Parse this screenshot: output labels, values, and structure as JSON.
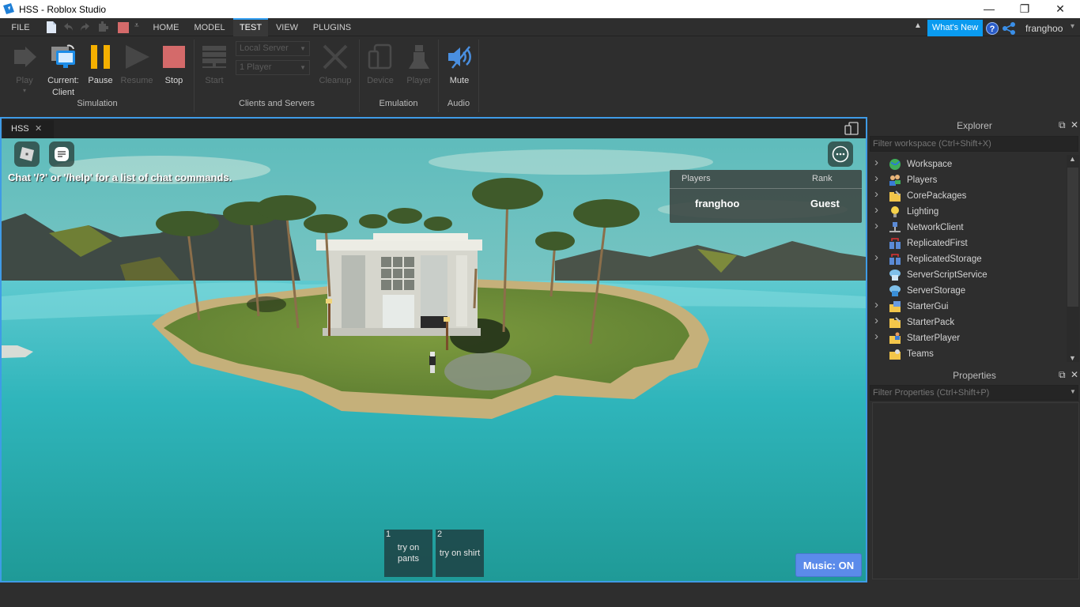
{
  "window": {
    "title": "HSS - Roblox Studio",
    "controls": {
      "minimize": "—",
      "restore": "❐",
      "close": "✕"
    }
  },
  "menubar": {
    "file": "FILE",
    "tabs": [
      {
        "label": "HOME",
        "active": false
      },
      {
        "label": "MODEL",
        "active": false
      },
      {
        "label": "TEST",
        "active": true
      },
      {
        "label": "VIEW",
        "active": false
      },
      {
        "label": "PLUGINS",
        "active": false
      }
    ],
    "quick_access_icons": [
      "new-file-icon",
      "undo-icon",
      "redo-icon",
      "plugin-icon",
      "stop-square-icon",
      "customize-icon"
    ],
    "whats_new": "What's New",
    "user": "franghoo",
    "collapse_glyph": "▲",
    "user_caret": "▾"
  },
  "ribbon": {
    "groups": [
      {
        "label": "Simulation"
      },
      {
        "label": "Clients and Servers"
      },
      {
        "label": "Emulation"
      },
      {
        "label": "Audio"
      }
    ],
    "buttons": {
      "play": {
        "label": "Play",
        "enabled": false
      },
      "current_client": {
        "label_1": "Current:",
        "label_2": "Client",
        "enabled": true
      },
      "pause": {
        "label": "Pause",
        "enabled": true
      },
      "resume": {
        "label": "Resume",
        "enabled": false
      },
      "stop": {
        "label": "Stop",
        "enabled": true
      },
      "start": {
        "label": "Start",
        "enabled": false
      },
      "cleanup": {
        "label": "Cleanup",
        "enabled": false
      },
      "device": {
        "label": "Device",
        "enabled": false
      },
      "player": {
        "label": "Player",
        "enabled": false
      },
      "mute": {
        "label": "Mute",
        "enabled": true
      }
    },
    "server_dropdown": "Local Server",
    "players_dropdown": "1 Player",
    "colors": {
      "pause": "#f5b000",
      "stop": "#d46a6a",
      "mute": "#4a8fe0"
    }
  },
  "document": {
    "tab_label": "HSS",
    "tab_close": "✕"
  },
  "game": {
    "chat_hint": "Chat '/?' or '/help' for a list of chat commands.",
    "leaderboard": {
      "headers": [
        "Players",
        "Rank"
      ],
      "rows": [
        {
          "player": "franghoo",
          "rank": "Guest"
        }
      ]
    },
    "hotbar": [
      {
        "slot": "1",
        "line1": "try on",
        "line2": "pants"
      },
      {
        "slot": "2",
        "line1": "try on shirt",
        "line2": ""
      }
    ],
    "music_button": "Music: ON"
  },
  "explorer": {
    "title": "Explorer",
    "filter_placeholder": "Filter workspace (Ctrl+Shift+X)",
    "items": [
      {
        "label": "Workspace",
        "expandable": true,
        "icon": "globe-icon"
      },
      {
        "label": "Players",
        "expandable": true,
        "icon": "players-icon"
      },
      {
        "label": "CorePackages",
        "expandable": true,
        "icon": "folder-tool-icon"
      },
      {
        "label": "Lighting",
        "expandable": true,
        "icon": "lightbulb-icon"
      },
      {
        "label": "NetworkClient",
        "expandable": true,
        "icon": "network-icon"
      },
      {
        "label": "ReplicatedFirst",
        "expandable": false,
        "icon": "replicated-icon"
      },
      {
        "label": "ReplicatedStorage",
        "expandable": true,
        "icon": "replicated-icon"
      },
      {
        "label": "ServerScriptService",
        "expandable": false,
        "icon": "server-script-icon"
      },
      {
        "label": "ServerStorage",
        "expandable": false,
        "icon": "server-storage-icon"
      },
      {
        "label": "StarterGui",
        "expandable": true,
        "icon": "folder-gui-icon"
      },
      {
        "label": "StarterPack",
        "expandable": true,
        "icon": "folder-tool-icon"
      },
      {
        "label": "StarterPlayer",
        "expandable": true,
        "icon": "folder-player-icon"
      },
      {
        "label": "Teams",
        "expandable": false,
        "icon": "folder-teams-icon"
      }
    ]
  },
  "properties": {
    "title": "Properties",
    "filter_placeholder": "Filter Properties (Ctrl+Shift+P)"
  }
}
